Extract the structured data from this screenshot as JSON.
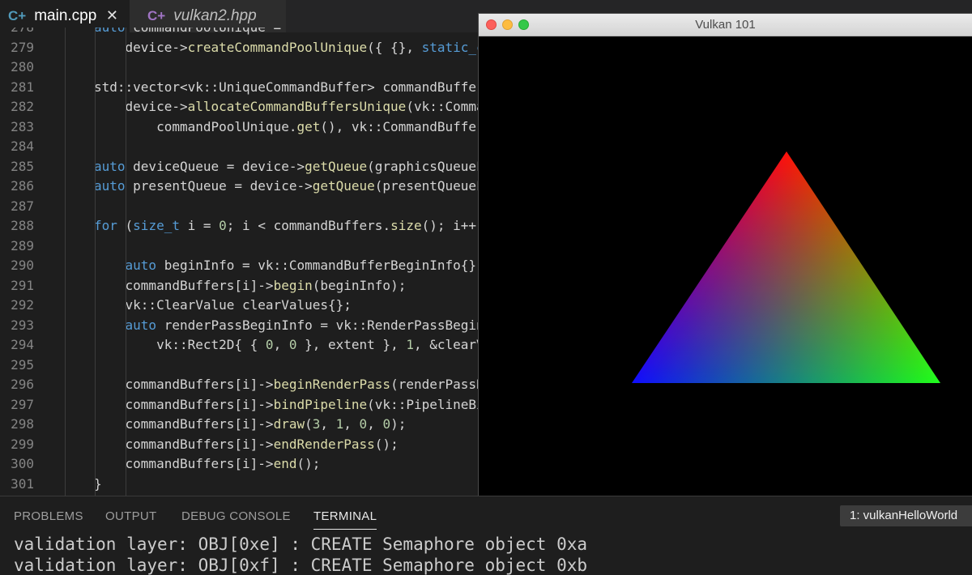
{
  "tabs": [
    {
      "label": "main.cpp",
      "icon": "C++ file icon",
      "active": true
    },
    {
      "label": "vulkan2.hpp",
      "icon": "C++ header icon",
      "active": false
    }
  ],
  "code_lines": [
    {
      "num": "278",
      "html": "<span class=\"kw\">auto</span> commandPoolUnique ="
    },
    {
      "num": "279",
      "html": "    device-><span class=\"fn\">createCommandPoolUnique</span>({ {}, <span class=\"kw\">static_ca</span>"
    },
    {
      "num": "280",
      "html": ""
    },
    {
      "num": "281",
      "html": "std::vector&lt;vk::UniqueCommandBuffer&gt; commandBuffer"
    },
    {
      "num": "282",
      "html": "    device-><span class=\"fn\">allocateCommandBuffersUnique</span>(vk::Comma"
    },
    {
      "num": "283",
      "html": "        commandPoolUnique.<span class=\"fn\">get</span>(), vk::CommandBuffer"
    },
    {
      "num": "284",
      "html": ""
    },
    {
      "num": "285",
      "html": "<span class=\"kw\">auto</span> deviceQueue = device-><span class=\"fn\">getQueue</span>(graphicsQueueFa"
    },
    {
      "num": "286",
      "html": "<span class=\"kw\">auto</span> presentQueue = device-><span class=\"fn\">getQueue</span>(presentQueueFa"
    },
    {
      "num": "287",
      "html": ""
    },
    {
      "num": "288",
      "html": "<span class=\"kw\">for</span> (<span class=\"kw\">size_t</span> i = <span class=\"num\">0</span>; i &lt; commandBuffers.<span class=\"fn\">size</span>(); i++)"
    },
    {
      "num": "289",
      "html": ""
    },
    {
      "num": "290",
      "html": "    <span class=\"kw\">auto</span> beginInfo = vk::CommandBufferBeginInfo{};"
    },
    {
      "num": "291",
      "html": "    commandBuffers[i]-><span class=\"fn\">begin</span>(beginInfo);"
    },
    {
      "num": "292",
      "html": "    vk::ClearValue clearValues{};"
    },
    {
      "num": "293",
      "html": "    <span class=\"kw\">auto</span> renderPassBeginInfo = vk::RenderPassBegin"
    },
    {
      "num": "294",
      "html": "        vk::Rect2D{ { <span class=\"num\">0</span>, <span class=\"num\">0</span> }, extent }, <span class=\"num\">1</span>, &amp;clearVa"
    },
    {
      "num": "295",
      "html": ""
    },
    {
      "num": "296",
      "html": "    commandBuffers[i]-><span class=\"fn\">beginRenderPass</span>(renderPassBe"
    },
    {
      "num": "297",
      "html": "    commandBuffers[i]-><span class=\"fn\">bindPipeline</span>(vk::PipelineBi"
    },
    {
      "num": "298",
      "html": "    commandBuffers[i]-><span class=\"fn\">draw</span>(<span class=\"num\">3</span>, <span class=\"num\">1</span>, <span class=\"num\">0</span>, <span class=\"num\">0</span>);"
    },
    {
      "num": "299",
      "html": "    commandBuffers[i]-><span class=\"fn\">endRenderPass</span>();"
    },
    {
      "num": "300",
      "html": "    commandBuffers[i]-><span class=\"fn\">end</span>();"
    },
    {
      "num": "301",
      "html": "}"
    }
  ],
  "app_window": {
    "title": "Vulkan 101"
  },
  "triangle": {
    "colors": [
      "#ff0000",
      "#1010ff",
      "#20ff20"
    ]
  },
  "panel": {
    "tabs": [
      "PROBLEMS",
      "OUTPUT",
      "DEBUG CONSOLE",
      "TERMINAL"
    ],
    "active_tab": "TERMINAL",
    "terminal_select": "1: vulkanHelloWorld",
    "terminal_lines": [
      "validation layer: OBJ[0xe] : CREATE Semaphore object 0xa",
      "validation layer: OBJ[0xf] : CREATE Semaphore object 0xb"
    ]
  },
  "theme": {
    "background": "#1e1e1e",
    "keyword": "#569cd6",
    "function": "#dcdcaa",
    "number": "#b5cea8"
  }
}
